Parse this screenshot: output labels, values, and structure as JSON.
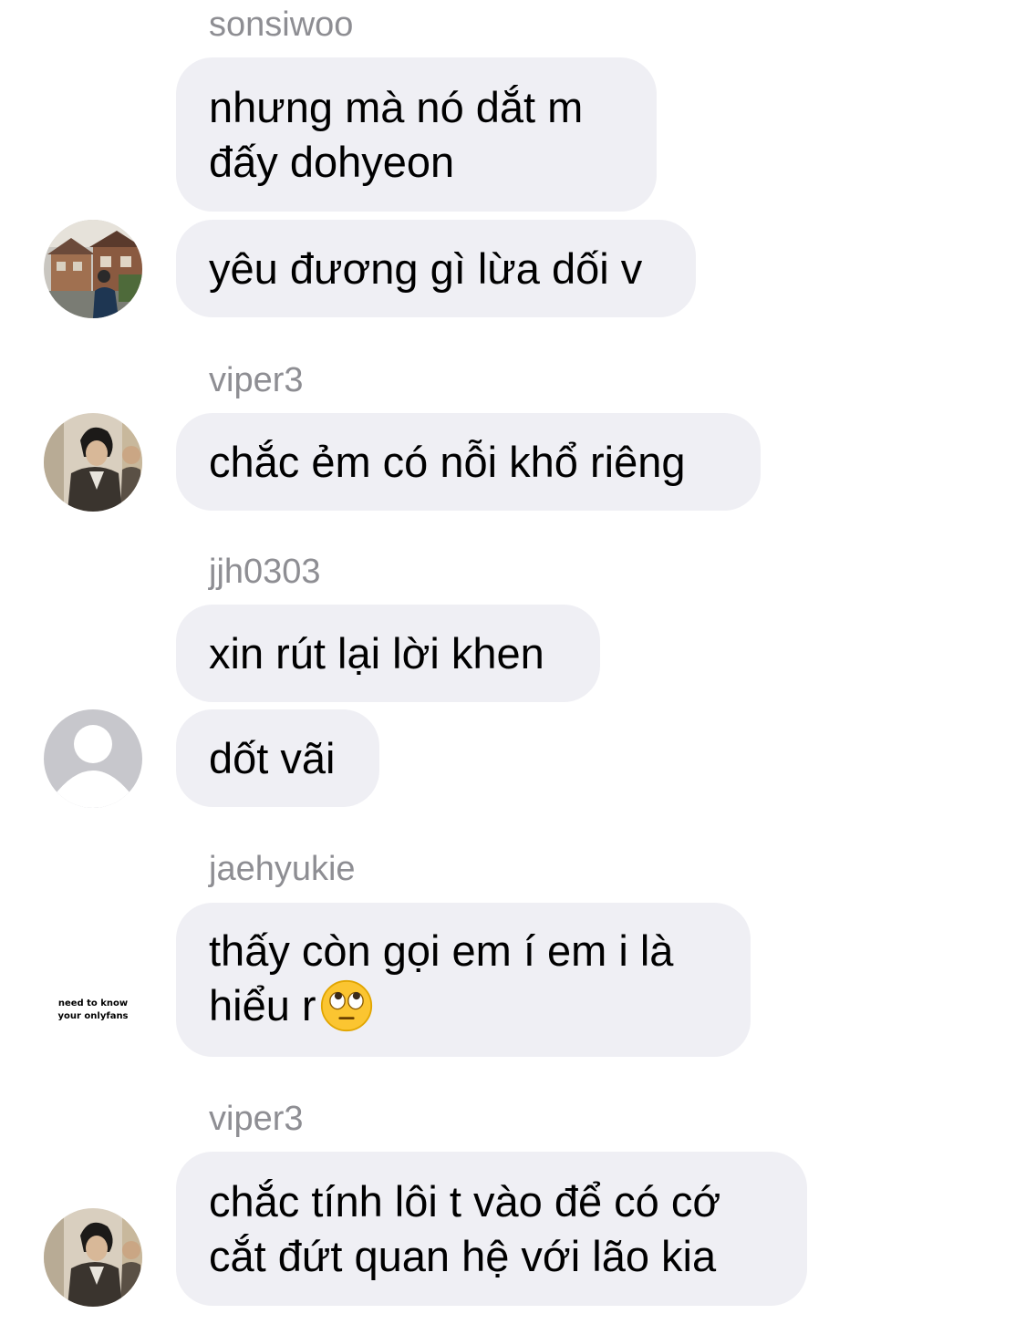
{
  "messages": [
    {
      "sender": "sonsiwoo",
      "lines": [
        "nhưng mà nó dắt m",
        "đấy dohyeon"
      ]
    },
    {
      "lines": [
        "yêu đương gì lừa dối v"
      ]
    },
    {
      "sender": "viper3",
      "lines": [
        "chắc ẻm có nỗi khổ riêng"
      ]
    },
    {
      "sender": "jjh0303",
      "lines": [
        "xin rút lại lời khen"
      ]
    },
    {
      "lines": [
        "dốt vãi"
      ]
    },
    {
      "sender": "jaehyukie",
      "lines": [
        "thấy còn gọi em í em i là",
        "hiểu r"
      ],
      "emoji": "face-with-rolling-eyes"
    },
    {
      "sender": "viper3",
      "lines": [
        "chắc tính lôi t vào để có cớ",
        "cắt đứt quan hệ với lão kia"
      ]
    }
  ],
  "avatars": [
    {
      "type": "photo",
      "icon": "street-houses-photo"
    },
    {
      "type": "photo",
      "icon": "person-in-suit-photo"
    },
    {
      "type": "placeholder",
      "icon": "default-person-icon"
    },
    {
      "type": "text",
      "lines": [
        "need to know",
        "your onlyfans"
      ]
    },
    {
      "type": "photo",
      "icon": "person-in-suit-photo"
    }
  ],
  "colors": {
    "bubble": "#efeff4",
    "sender": "#8e8e93",
    "text": "#000000",
    "placeholder": "#c7c7cc"
  }
}
